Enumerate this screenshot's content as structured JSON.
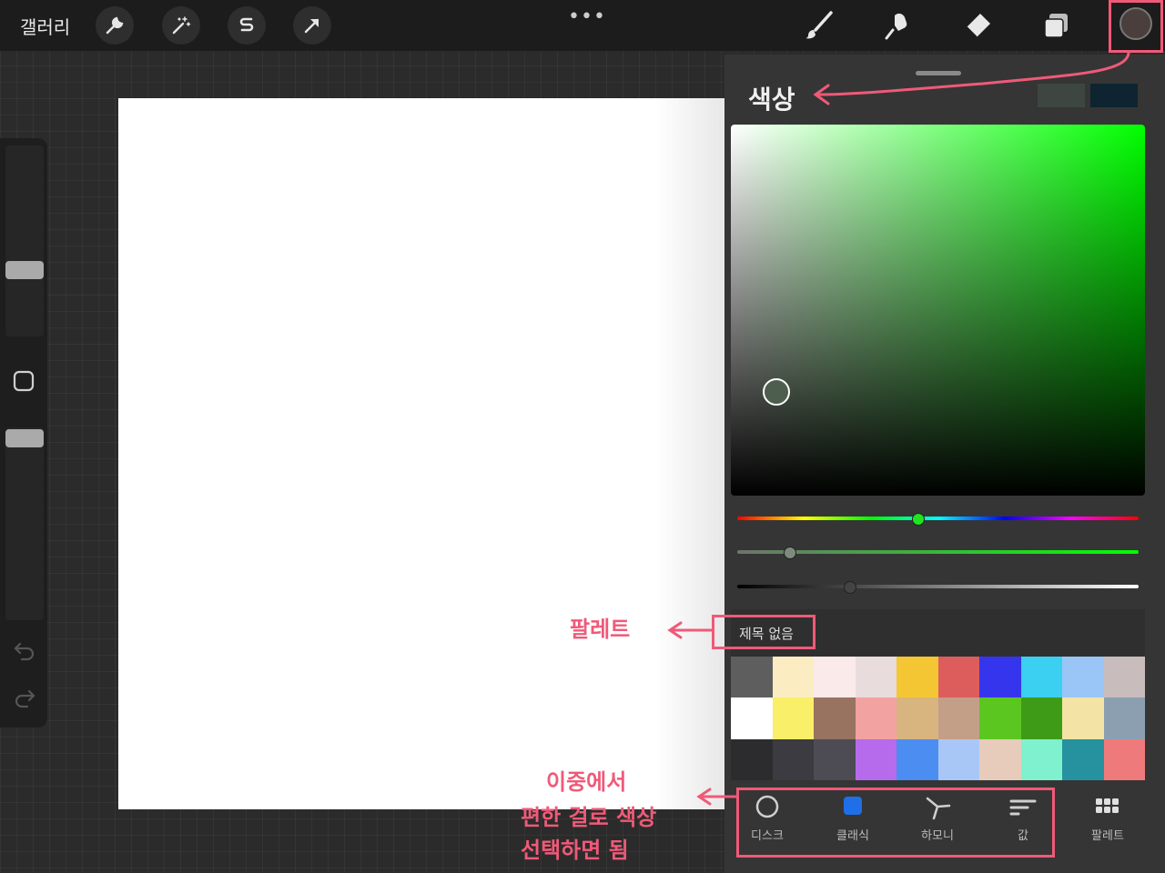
{
  "topbar": {
    "gallery_label": "갤러리",
    "more_label": "•••",
    "left_tools": [
      "wrench-icon",
      "magic-wand-icon",
      "selection-s-icon",
      "arrow-transform-icon"
    ],
    "right_tools": [
      "brush-icon",
      "smudge-icon",
      "eraser-icon",
      "layers-icon"
    ],
    "current_color": "#4a3f3c"
  },
  "sidebar": {
    "size_slider_level": 0.55,
    "opacity_slider_level": 0.6,
    "icons": [
      "modify-square-icon",
      "undo-icon",
      "redo-icon"
    ]
  },
  "color_panel": {
    "title": "색상",
    "previous_colors": [
      "#3d4640",
      "#0e2430"
    ],
    "hue_level": 0.45,
    "saturation_level": 0.13,
    "brightness_level": 0.28,
    "selected_color": "#4e5e4e",
    "palette": {
      "name": "제목 없음",
      "swatches": [
        "#5e5e5e",
        "#fbedc1",
        "#fbeaea",
        "#e9dcdc",
        "#f4c634",
        "#dc5d5c",
        "#3535ee",
        "#3bcff2",
        "#99c6f6",
        "#c9bcbc",
        "#ffffff",
        "#faef68",
        "#987360",
        "#f3a2a2",
        "#d8b47f",
        "#c29f86",
        "#5cc620",
        "#3e9b17",
        "#f3e3a4",
        "#8b9fb1",
        "#2c2c2e",
        "#3b3b41",
        "#4d4c54",
        "#b66bec",
        "#4c8df1",
        "#a9c7f6",
        "#e7ccbc",
        "#7ff1cf",
        "#26929f",
        "#ef7a7b"
      ]
    },
    "tabs": [
      {
        "label": "디스크",
        "icon": "disc-icon"
      },
      {
        "label": "클래식",
        "icon": "classic-square-icon"
      },
      {
        "label": "하모니",
        "icon": "harmony-icon"
      },
      {
        "label": "값",
        "icon": "value-sliders-icon"
      },
      {
        "label": "팔레트",
        "icon": "palette-grid-icon"
      }
    ]
  },
  "annotations": {
    "palette_note": "팔레트",
    "mode_note_line1": "이중에서",
    "mode_note_line2": "편한 걸로 색상",
    "mode_note_line3": "선택하면 됨",
    "accent_color": "#ef5a78"
  }
}
